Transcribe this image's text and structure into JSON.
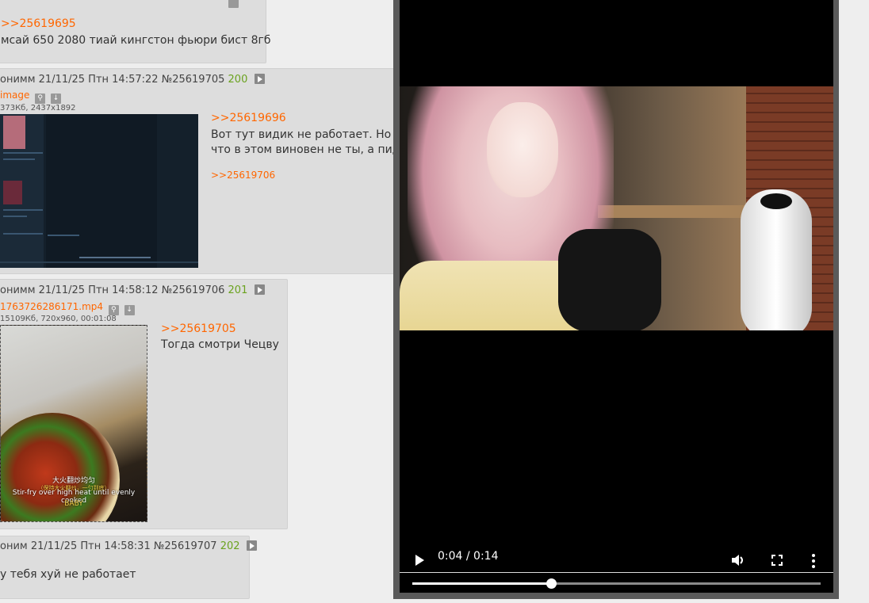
{
  "post1": {
    "reply_link": ">>25619695",
    "text": "мсай 650 2080 тиай кингстон фьюри бист 8гб"
  },
  "post2": {
    "author": "онимм 21/11/25 Птн 14:57:22",
    "post_num": "№25619705",
    "replies": "200",
    "file_name": "image",
    "file_info": "373Кб, 2437x1892",
    "reply_link": ">>25619696",
    "text_line1": "Вот тут видик не работает. Но я к",
    "text_line2": "что в этом виновен не ты, а пидо",
    "backlink": ">>25619706"
  },
  "post3": {
    "author": "онимм 21/11/25 Птн 14:58:12",
    "post_num": "№25619706",
    "replies": "201",
    "file_name": "1763726286171.mp4",
    "file_info": "15109Кб, 720x960, 00:01:08",
    "reply_link": ">>25619705",
    "text": "Тогда смотри Чецву",
    "thumb_sub_cn": "大火翻炒均匀",
    "thumb_sub_cn2": "（保持大火翻炒，一勺到底）",
    "thumb_sub_en": "Stir-fry over high heat until evenly cooked",
    "thumb_sub_baby": "BABY"
  },
  "post4": {
    "author": "оним 21/11/25 Птн 14:58:31",
    "post_num": "№25619707",
    "replies": "202",
    "text": "у тебя хуй не работает"
  },
  "player": {
    "time": "0:04 / 0:14",
    "progress": 0.34
  }
}
